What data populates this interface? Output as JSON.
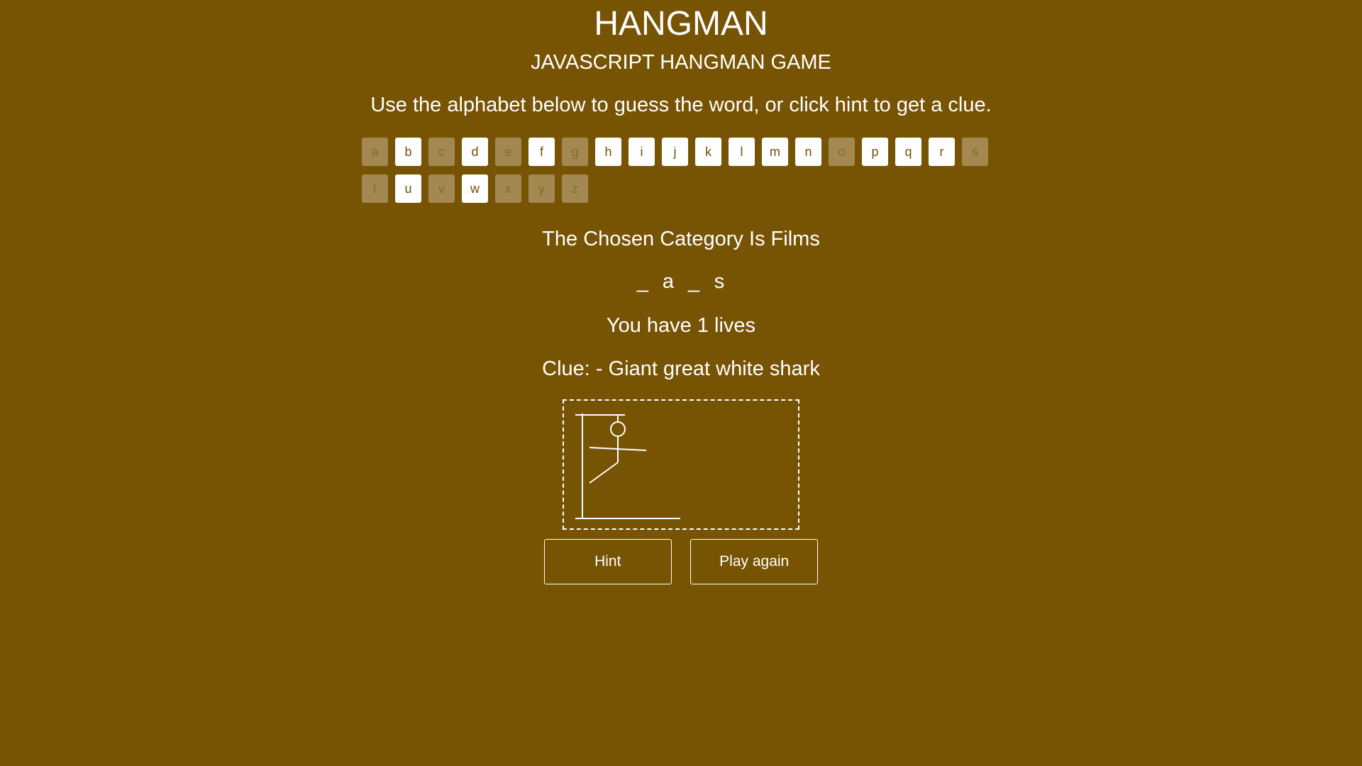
{
  "header": {
    "title": "HANGMAN",
    "subtitle": "JAVASCRIPT HANGMAN GAME",
    "instructions": "Use the alphabet below to guess the word, or click hint to get a clue."
  },
  "alphabet": [
    {
      "letter": "a",
      "used": true
    },
    {
      "letter": "b",
      "used": false
    },
    {
      "letter": "c",
      "used": true
    },
    {
      "letter": "d",
      "used": false
    },
    {
      "letter": "e",
      "used": true
    },
    {
      "letter": "f",
      "used": false
    },
    {
      "letter": "g",
      "used": true
    },
    {
      "letter": "h",
      "used": false
    },
    {
      "letter": "i",
      "used": false
    },
    {
      "letter": "j",
      "used": false
    },
    {
      "letter": "k",
      "used": false
    },
    {
      "letter": "l",
      "used": false
    },
    {
      "letter": "m",
      "used": false
    },
    {
      "letter": "n",
      "used": false
    },
    {
      "letter": "o",
      "used": true
    },
    {
      "letter": "p",
      "used": false
    },
    {
      "letter": "q",
      "used": false
    },
    {
      "letter": "r",
      "used": false
    },
    {
      "letter": "s",
      "used": true
    },
    {
      "letter": "t",
      "used": true
    },
    {
      "letter": "u",
      "used": false
    },
    {
      "letter": "v",
      "used": true
    },
    {
      "letter": "w",
      "used": false
    },
    {
      "letter": "x",
      "used": true
    },
    {
      "letter": "y",
      "used": true
    },
    {
      "letter": "z",
      "used": true
    }
  ],
  "game": {
    "category": "The Chosen Category Is Films",
    "word": [
      "_",
      "a",
      "_",
      "s"
    ],
    "lives": "You have 1 lives",
    "clue": "Clue: - Giant great white shark"
  },
  "buttons": {
    "hint": "Hint",
    "play_again": "Play again"
  },
  "colors": {
    "background": "#775304",
    "foreground": "#ffffff",
    "used_letter": "#a68b57"
  }
}
